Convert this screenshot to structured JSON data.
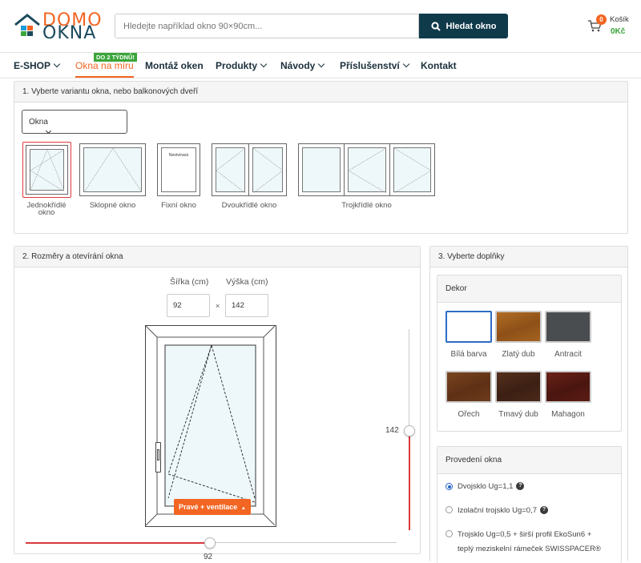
{
  "header": {
    "logo_top": "DOMO",
    "logo_bottom": "OKNA",
    "search_placeholder": "Hledejte například okno 90×90cm...",
    "search_button": "Hledat okno",
    "cart_count": "0",
    "cart_label": "Košík",
    "cart_total": "0Kč"
  },
  "nav": {
    "items": [
      {
        "label": "E-SHOP",
        "has_chevron": true
      },
      {
        "label": "Okna na míru",
        "badge": "DO 2 TÝDNŮ!",
        "active": true
      },
      {
        "label": "Montáž oken"
      },
      {
        "label": "Produkty",
        "has_chevron": true
      },
      {
        "label": "Návody",
        "has_chevron": true
      },
      {
        "label": "Příslušenství",
        "has_chevron": true
      },
      {
        "label": "Kontakt"
      }
    ]
  },
  "step1": {
    "title": "1. Vyberte variantu okna, nebo balkonových dveří",
    "select_value": "Okna",
    "variants": [
      {
        "label": "Jednokřídlé okno",
        "selected": true
      },
      {
        "label": "Sklopné okno"
      },
      {
        "label": "Fixní okno",
        "inner_text": "Neotvíravá"
      },
      {
        "label": "Dvoukřídlé okno"
      },
      {
        "label": "Trojkřídlé okno"
      }
    ]
  },
  "step2": {
    "title": "2. Rozměry a otevírání okna",
    "width_label": "Šířka (cm)",
    "height_label": "Výška (cm)",
    "times": "×",
    "width_value": "92",
    "height_value": "142",
    "opening_button": "Pravé + ventilace",
    "height_slider_value": "142",
    "width_slider_value": "92"
  },
  "step3": {
    "title": "3. Vyberte doplňky",
    "decor_title": "Dekor",
    "decors": [
      {
        "label": "Bílá barva",
        "color": "#ffffff",
        "selected": true
      },
      {
        "label": "Zlatý dub",
        "color": "#a0621f"
      },
      {
        "label": "Antracit",
        "color": "#4a4d50"
      },
      {
        "label": "Ořech",
        "color": "#6b3a1c"
      },
      {
        "label": "Tmavý dub",
        "color": "#4a2718"
      },
      {
        "label": "Mahagon",
        "color": "#5a1c14"
      }
    ],
    "glazing_title": "Provedení okna",
    "glazing": [
      {
        "label": "Dvojsklo Ug=1,1",
        "checked": true,
        "help": "?"
      },
      {
        "label": "Izolační trojsklo Ug=0,7",
        "help": "?"
      },
      {
        "label": "Trojsklo Ug=0,5 + širší profil EkoSun6 +",
        "label2": "teplý meziskelní rámeček SWISSPACER®"
      }
    ]
  },
  "colors": {
    "brand_orange": "#f26522",
    "brand_navy": "#0f3a4a",
    "badge_green": "#3aa53a",
    "slider_red": "#d9393c"
  }
}
